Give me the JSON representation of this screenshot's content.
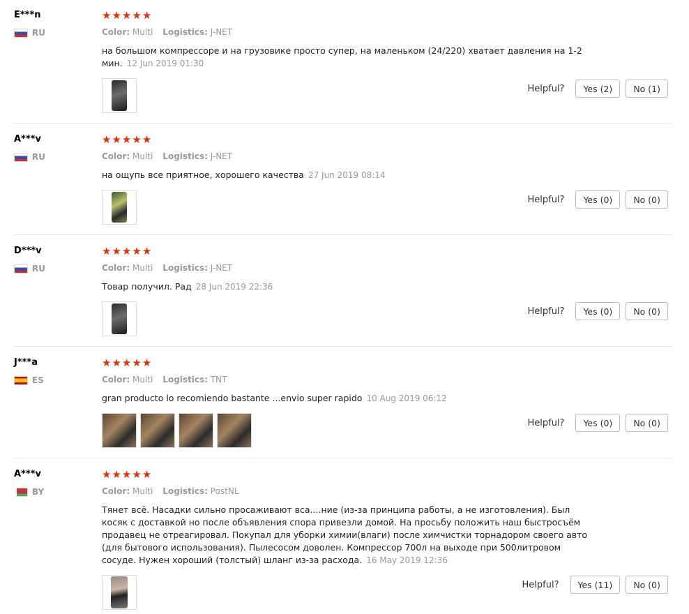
{
  "helpful_label": "Helpful?",
  "star_icon": "star-icon",
  "star_color": "#e62e04",
  "rating_scale": 5,
  "reviews": [
    {
      "user": "E***n",
      "country": "RU",
      "rating": 5,
      "color_label": "Color:",
      "color_value": "Multi",
      "logistics_label": "Logistics:",
      "logistics_value": "J-NET",
      "text": "на большом компрессоре и на грузовике просто супер, на маленьком (24/220) хватает давления на 1-2 мин.",
      "date": "12 Jun 2019 01:30",
      "yes": "Yes (2)",
      "no": "No (1)"
    },
    {
      "user": "A***v",
      "country": "RU",
      "rating": 5,
      "color_label": "Color:",
      "color_value": "Multi",
      "logistics_label": "Logistics:",
      "logistics_value": "J-NET",
      "text": "на ощупь все приятное, хорошего качества",
      "date": "27 Jun 2019 08:14",
      "yes": "Yes (0)",
      "no": "No (0)"
    },
    {
      "user": "D***v",
      "country": "RU",
      "rating": 5,
      "color_label": "Color:",
      "color_value": "Multi",
      "logistics_label": "Logistics:",
      "logistics_value": "J-NET",
      "text": "Товар получил. Рад",
      "date": "28 Jun 2019 22:36",
      "yes": "Yes (0)",
      "no": "No (0)"
    },
    {
      "user": "J***a",
      "country": "ES",
      "rating": 5,
      "color_label": "Color:",
      "color_value": "Multi",
      "logistics_label": "Logistics:",
      "logistics_value": "TNT",
      "text": "gran producto lo recomiendo bastante ...envio super rapido",
      "date": "10 Aug 2019 06:12",
      "yes": "Yes (0)",
      "no": "No (0)"
    },
    {
      "user": "A***v",
      "country": "BY",
      "rating": 5,
      "color_label": "Color:",
      "color_value": "Multi",
      "logistics_label": "Logistics:",
      "logistics_value": "PostNL",
      "text": "Тянет всё. Насадки сильно просаживают вса....ние (из-за принципа работы, а не изготовления). Был косяк с доставкой но после объявления спора привезли домой. На просьбу положить наш быстросъём продавец не отреагировал. Покупал для уборки химии(влаги) после химчистки торнадором своего авто (для бытового использования). Пылесосом доволен. Компрессор 700л на выходе при 500литровом сосуде. Нужен хороший (толстый) шланг из-за расхода.",
      "date": "16 May 2019 12:36",
      "yes": "Yes (11)",
      "no": "No (0)"
    }
  ]
}
